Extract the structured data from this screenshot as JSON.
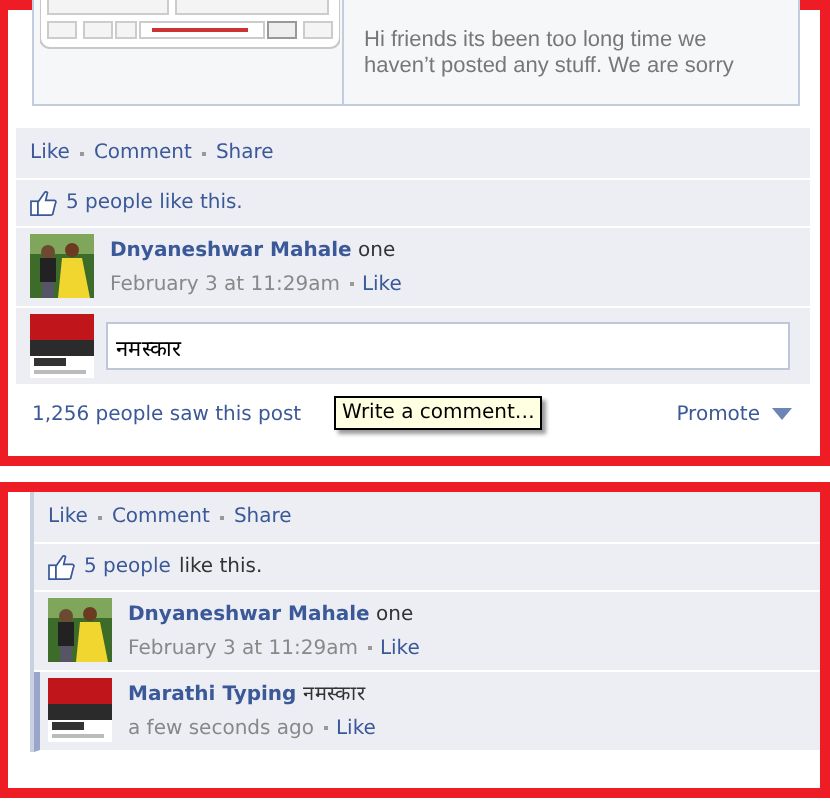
{
  "panels": [
    {
      "kind": "editing",
      "attachment": {
        "kind": "picture",
        "description": "Hi friends its been too long time we haven’t posted any stuff. We are sorry"
      },
      "actions": [
        "Like",
        "Comment",
        "Share"
      ],
      "likes": {
        "text": "5 people like this."
      },
      "comments": [
        {
          "author": "Dnyaneshwar Mahale",
          "text": "one",
          "time": "February 3 at 11:29am",
          "like": "Like",
          "new": false
        }
      ],
      "composer": {
        "value": "नमस्कार"
      },
      "footer": {
        "seen": "1,256 people saw this post",
        "promote": "Promote"
      },
      "tooltip": "Write a comment…"
    },
    {
      "kind": "posted",
      "actions": [
        "Like",
        "Comment",
        "Share"
      ],
      "likes": {
        "link": "5 people",
        "text": "like this."
      },
      "comments": [
        {
          "author": "Dnyaneshwar Mahale",
          "text": "one",
          "time": "February 3 at 11:29am",
          "like": "Like",
          "new": false
        },
        {
          "author": "Marathi Typing",
          "text": "नमस्कार",
          "time": "a few seconds ago",
          "like": "Like",
          "new": true
        }
      ]
    }
  ]
}
